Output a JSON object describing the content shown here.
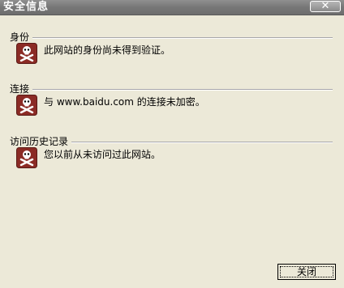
{
  "window": {
    "title": "安全信息",
    "close_glyph": "✕"
  },
  "sections": [
    {
      "heading": "身份",
      "message": "此网站的身份尚未得到验证。",
      "icon": "skull-crossbones-icon"
    },
    {
      "heading": "连接",
      "message": "与 www.baidu.com 的连接未加密。",
      "icon": "skull-crossbones-icon"
    },
    {
      "heading": "访问历史记录",
      "message": "您以前从未访问过此网站。",
      "icon": "skull-crossbones-icon"
    }
  ],
  "buttons": {
    "close_label": "关闭"
  },
  "colors": {
    "titlebar": "#7a7a7a",
    "icon_bg": "#8b2b25",
    "dialog_bg": "#ece9d8"
  }
}
